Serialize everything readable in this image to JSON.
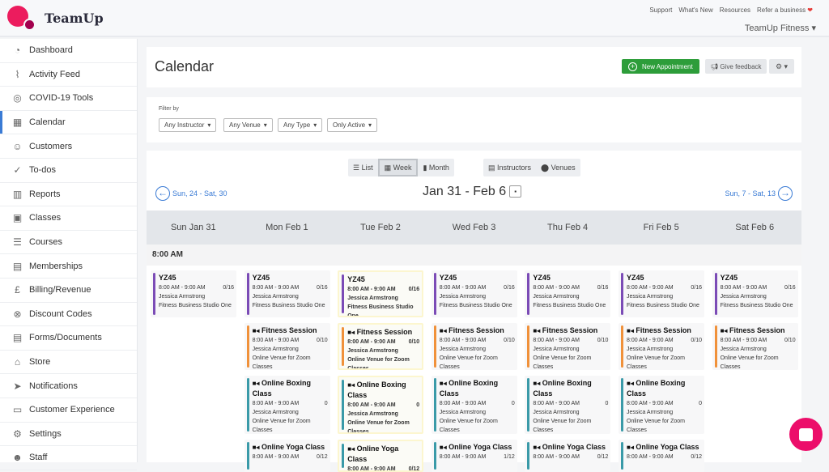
{
  "brand": "TeamUp",
  "toplinks": [
    "Support",
    "What's New",
    "Resources",
    "Refer a business"
  ],
  "business": "TeamUp Fitness",
  "sidebar": [
    {
      "label": "Dashboard",
      "icon": "◔"
    },
    {
      "label": "Activity Feed",
      "icon": "⌇"
    },
    {
      "label": "COVID-19 Tools",
      "icon": "◎"
    },
    {
      "label": "Calendar",
      "icon": "▦",
      "active": true
    },
    {
      "label": "Customers",
      "icon": "☺"
    },
    {
      "label": "To-dos",
      "icon": "✓"
    },
    {
      "label": "Reports",
      "icon": "▥"
    },
    {
      "label": "Classes",
      "icon": "▣"
    },
    {
      "label": "Courses",
      "icon": "☰"
    },
    {
      "label": "Memberships",
      "icon": "▤"
    },
    {
      "label": "Billing/Revenue",
      "icon": "£"
    },
    {
      "label": "Discount Codes",
      "icon": "⊗"
    },
    {
      "label": "Forms/Documents",
      "icon": "▤"
    },
    {
      "label": "Store",
      "icon": "⌂"
    },
    {
      "label": "Notifications",
      "icon": "➤"
    },
    {
      "label": "Customer Experience",
      "icon": "▭"
    },
    {
      "label": "Settings",
      "icon": "⚙"
    },
    {
      "label": "Staff",
      "icon": "☻"
    }
  ],
  "page_title": "Calendar",
  "actions": {
    "new": "New Appointment",
    "feedback": "Give feedback",
    "gear": "⚙ ▾"
  },
  "filter": {
    "label": "Filter by",
    "dropdowns": [
      "Any Instructor",
      "Any Venue",
      "Any Type",
      "Only Active"
    ]
  },
  "views": {
    "list": "List",
    "week": "Week",
    "month": "Month",
    "instructors": "Instructors",
    "venues": "Venues"
  },
  "nav": {
    "prev": "Sun, 24 - Sat, 30",
    "next": "Sun, 7 - Sat, 13",
    "range": "Jan 31 - Feb 6"
  },
  "time_slot": "8:00 AM",
  "colors": {
    "purple": "#7b4bb6",
    "orange": "#f0913a",
    "teal": "#3a9aa8"
  },
  "event_types": {
    "yz": {
      "title": "YZ45",
      "time": "8:00 AM - 9:00 AM",
      "count": "0/16",
      "instructor": "Jessica Armstrong",
      "venue": "Fitness Business Studio One",
      "color": "#7b4bb6",
      "video": false
    },
    "fit": {
      "title": "Fitness Session",
      "time": "8:00 AM - 9:00 AM",
      "count": "0/10",
      "instructor": "Jessica Armstrong",
      "venue": "Online Venue for Zoom Classes",
      "color": "#f0913a",
      "video": true
    },
    "box": {
      "title": "Online Boxing Class",
      "time": "8:00 AM - 9:00 AM",
      "count": "0",
      "instructor": "Jessica Armstrong",
      "venue": "Online Venue for Zoom Classes",
      "color": "#3a9aa8",
      "video": true
    },
    "yoga": {
      "title": "Online Yoga Class",
      "time": "8:00 AM - 9:00 AM",
      "count": "0/12",
      "color": "#3a9aa8",
      "video": true
    }
  },
  "days": [
    {
      "label": "Sun Jan 31",
      "events": [
        "yz"
      ]
    },
    {
      "label": "Mon Feb 1",
      "events": [
        "yz",
        "fit",
        "box",
        "yoga"
      ]
    },
    {
      "label": "Tue Feb 2",
      "events": [
        "yz",
        "fit",
        "box",
        "yoga"
      ],
      "today": true
    },
    {
      "label": "Wed Feb 3",
      "events": [
        "yz",
        "fit",
        "box",
        "yoga"
      ],
      "yoga_count": "1/12"
    },
    {
      "label": "Thu Feb 4",
      "events": [
        "yz",
        "fit",
        "box",
        "yoga"
      ]
    },
    {
      "label": "Fri Feb 5",
      "events": [
        "yz",
        "fit",
        "box",
        "yoga"
      ]
    },
    {
      "label": "Sat Feb 6",
      "events": [
        "yz",
        "fit"
      ]
    }
  ]
}
